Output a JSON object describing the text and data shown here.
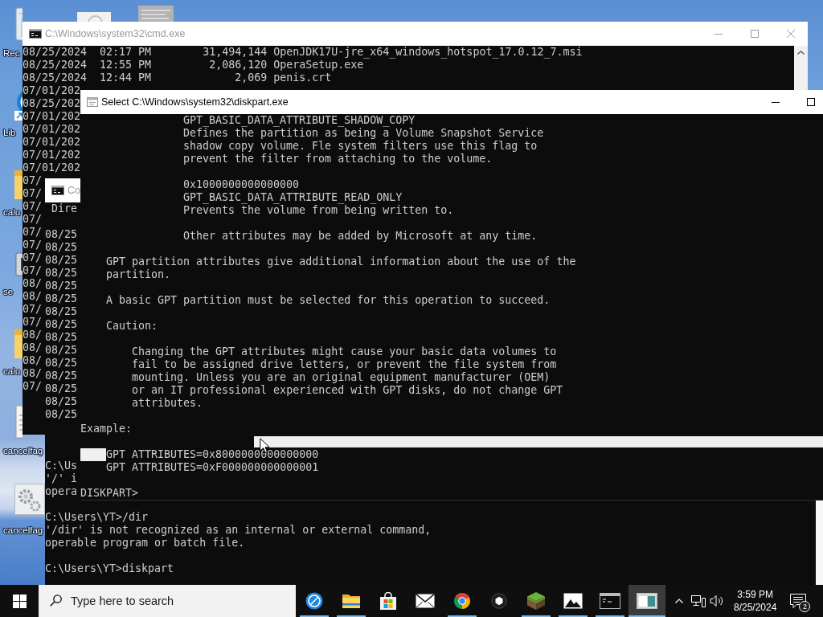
{
  "desktop": {
    "columns": [
      [
        {
          "kind": "bin",
          "label": "Rec"
        },
        {
          "kind": "shortcut",
          "label": "Lib"
        },
        {
          "kind": "folder",
          "label": "calu"
        },
        {
          "kind": "program",
          "label": "se"
        },
        {
          "kind": "folder",
          "label": "calu"
        },
        {
          "kind": "document",
          "label": "cancelfag"
        },
        {
          "kind": "gears",
          "label": "cancelfag"
        }
      ],
      [
        {
          "kind": "thumbnail"
        }
      ],
      [
        {
          "kind": "picture"
        }
      ]
    ]
  },
  "windows": [
    {
      "kind": "command-prompt",
      "title": "C:\\Windows\\system32\\cmd.exe",
      "active": false,
      "controls": [
        {
          "kind": "minimize"
        },
        {
          "kind": "maximize"
        },
        {
          "kind": "close"
        }
      ],
      "blocks": [
        {
          "kind": "line",
          "lines": [
            "08/25/2024  02:17 PM        31,494,144 OpenJDK17U-jre_x64_windows_hotspot_17.0.12_7.msi",
            "08/25/2024  12:55 PM         2,086,120 OperaSetup.exe",
            "08/25/2024  12:44 PM             2,069 penis.crt",
            "07/01/202",
            "08/25/202",
            "07/01/202",
            "07/01/202",
            "07/01/202",
            "07/01/202",
            "07/01/202",
            "07/",
            "07/",
            "07/",
            "07/",
            "07/",
            "07/",
            "07/",
            "07/",
            "08/",
            "08/",
            "07/",
            "07/",
            "08/",
            "08/",
            "08/",
            "08/",
            "07/"
          ]
        }
      ]
    },
    {
      "kind": "command-prompt",
      "title": "Co",
      "active": false,
      "blocks": [
        {
          "kind": "heading",
          "lines": [
            "Dire"
          ]
        },
        {
          "kind": "line",
          "lines": [
            "08/25",
            "08/25",
            "08/25",
            "08/25",
            "08/25",
            "08/25",
            "08/25",
            "08/25",
            "08/25",
            "08/25",
            "08/25",
            "08/25",
            "08/25",
            "08/25",
            "08/25"
          ]
        },
        {
          "kind": "line",
          "lines": [
            "C:\\Us",
            "'/' i",
            "opera"
          ]
        },
        {
          "kind": "line",
          "lines": [
            "C:\\Users\\YT>/dir",
            "'/dir' is not recognized as an internal or external command,",
            "operable program or batch file."
          ]
        },
        {
          "kind": "line",
          "lines": [
            "C:\\Users\\YT>diskpart"
          ]
        }
      ]
    },
    {
      "kind": "diskpart",
      "title": "Select C:\\Windows\\system32\\diskpart.exe",
      "active": true,
      "controls": [
        {
          "kind": "minimize"
        },
        {
          "kind": "maximize"
        }
      ],
      "blocks": [
        {
          "kind": "detail",
          "lines": [
            "GPT_BASIC_DATA_ATTRIBUTE_SHADOW_COPY",
            "Defines the partition as being a Volume Snapshot Service",
            "shadow copy volume. Fle system filters use this flag to",
            "prevent the filter from attaching to the volume."
          ]
        },
        {
          "kind": "detail",
          "lines": [
            "0x1000000000000000",
            "GPT_BASIC_DATA_ATTRIBUTE_READ_ONLY",
            "Prevents the volume from being written to."
          ]
        },
        {
          "kind": "detail",
          "lines": [
            "Other attributes may be added by Microsoft at any time."
          ]
        },
        {
          "kind": "text",
          "lines": [
            "GPT partition attributes give additional information about the use of the",
            "partition."
          ]
        },
        {
          "kind": "text",
          "lines": [
            "A basic GPT partition must be selected for this operation to succeed."
          ]
        },
        {
          "kind": "text",
          "lines": [
            "Caution:"
          ]
        },
        {
          "kind": "caution",
          "lines": [
            "Changing the GPT attributes might cause your basic data volumes to",
            "fail to be assigned drive letters, or prevent the file system from",
            "mounting. Unless you are an original equipment manufacturer (OEM)",
            "or an IT professional experienced with GPT disks, do not change GPT",
            "attributes."
          ]
        },
        {
          "kind": "label",
          "lines": [
            "Example:"
          ]
        },
        {
          "kind": "example",
          "selection": true,
          "lines": [
            "GPT ATTRIBUTES=0x8000000000000000",
            "GPT ATTRIBUTES=0xF000000000000001"
          ]
        },
        {
          "kind": "prompt",
          "lines": [
            "DISKPART>"
          ]
        }
      ]
    }
  ],
  "taskbar": {
    "search": {
      "placeholder": "Type here to search"
    },
    "apps": [
      {
        "kind": "disc",
        "running": true,
        "selected": false
      },
      {
        "kind": "folder",
        "running": true,
        "selected": false
      },
      {
        "kind": "store",
        "running": false,
        "selected": false
      },
      {
        "kind": "mail",
        "running": false,
        "selected": false
      },
      {
        "kind": "browser",
        "running": true,
        "selected": false
      },
      {
        "kind": "dot",
        "running": false,
        "selected": false
      },
      {
        "kind": "cube",
        "running": true,
        "selected": false
      },
      {
        "kind": "picture",
        "running": true,
        "selected": false
      },
      {
        "kind": "terminal",
        "running": true,
        "selected": false
      },
      {
        "kind": "window",
        "running": true,
        "selected": true
      }
    ],
    "clock": {
      "time": "3:59 PM",
      "date": "8/25/2024"
    },
    "notifications": {
      "count": "2"
    }
  }
}
